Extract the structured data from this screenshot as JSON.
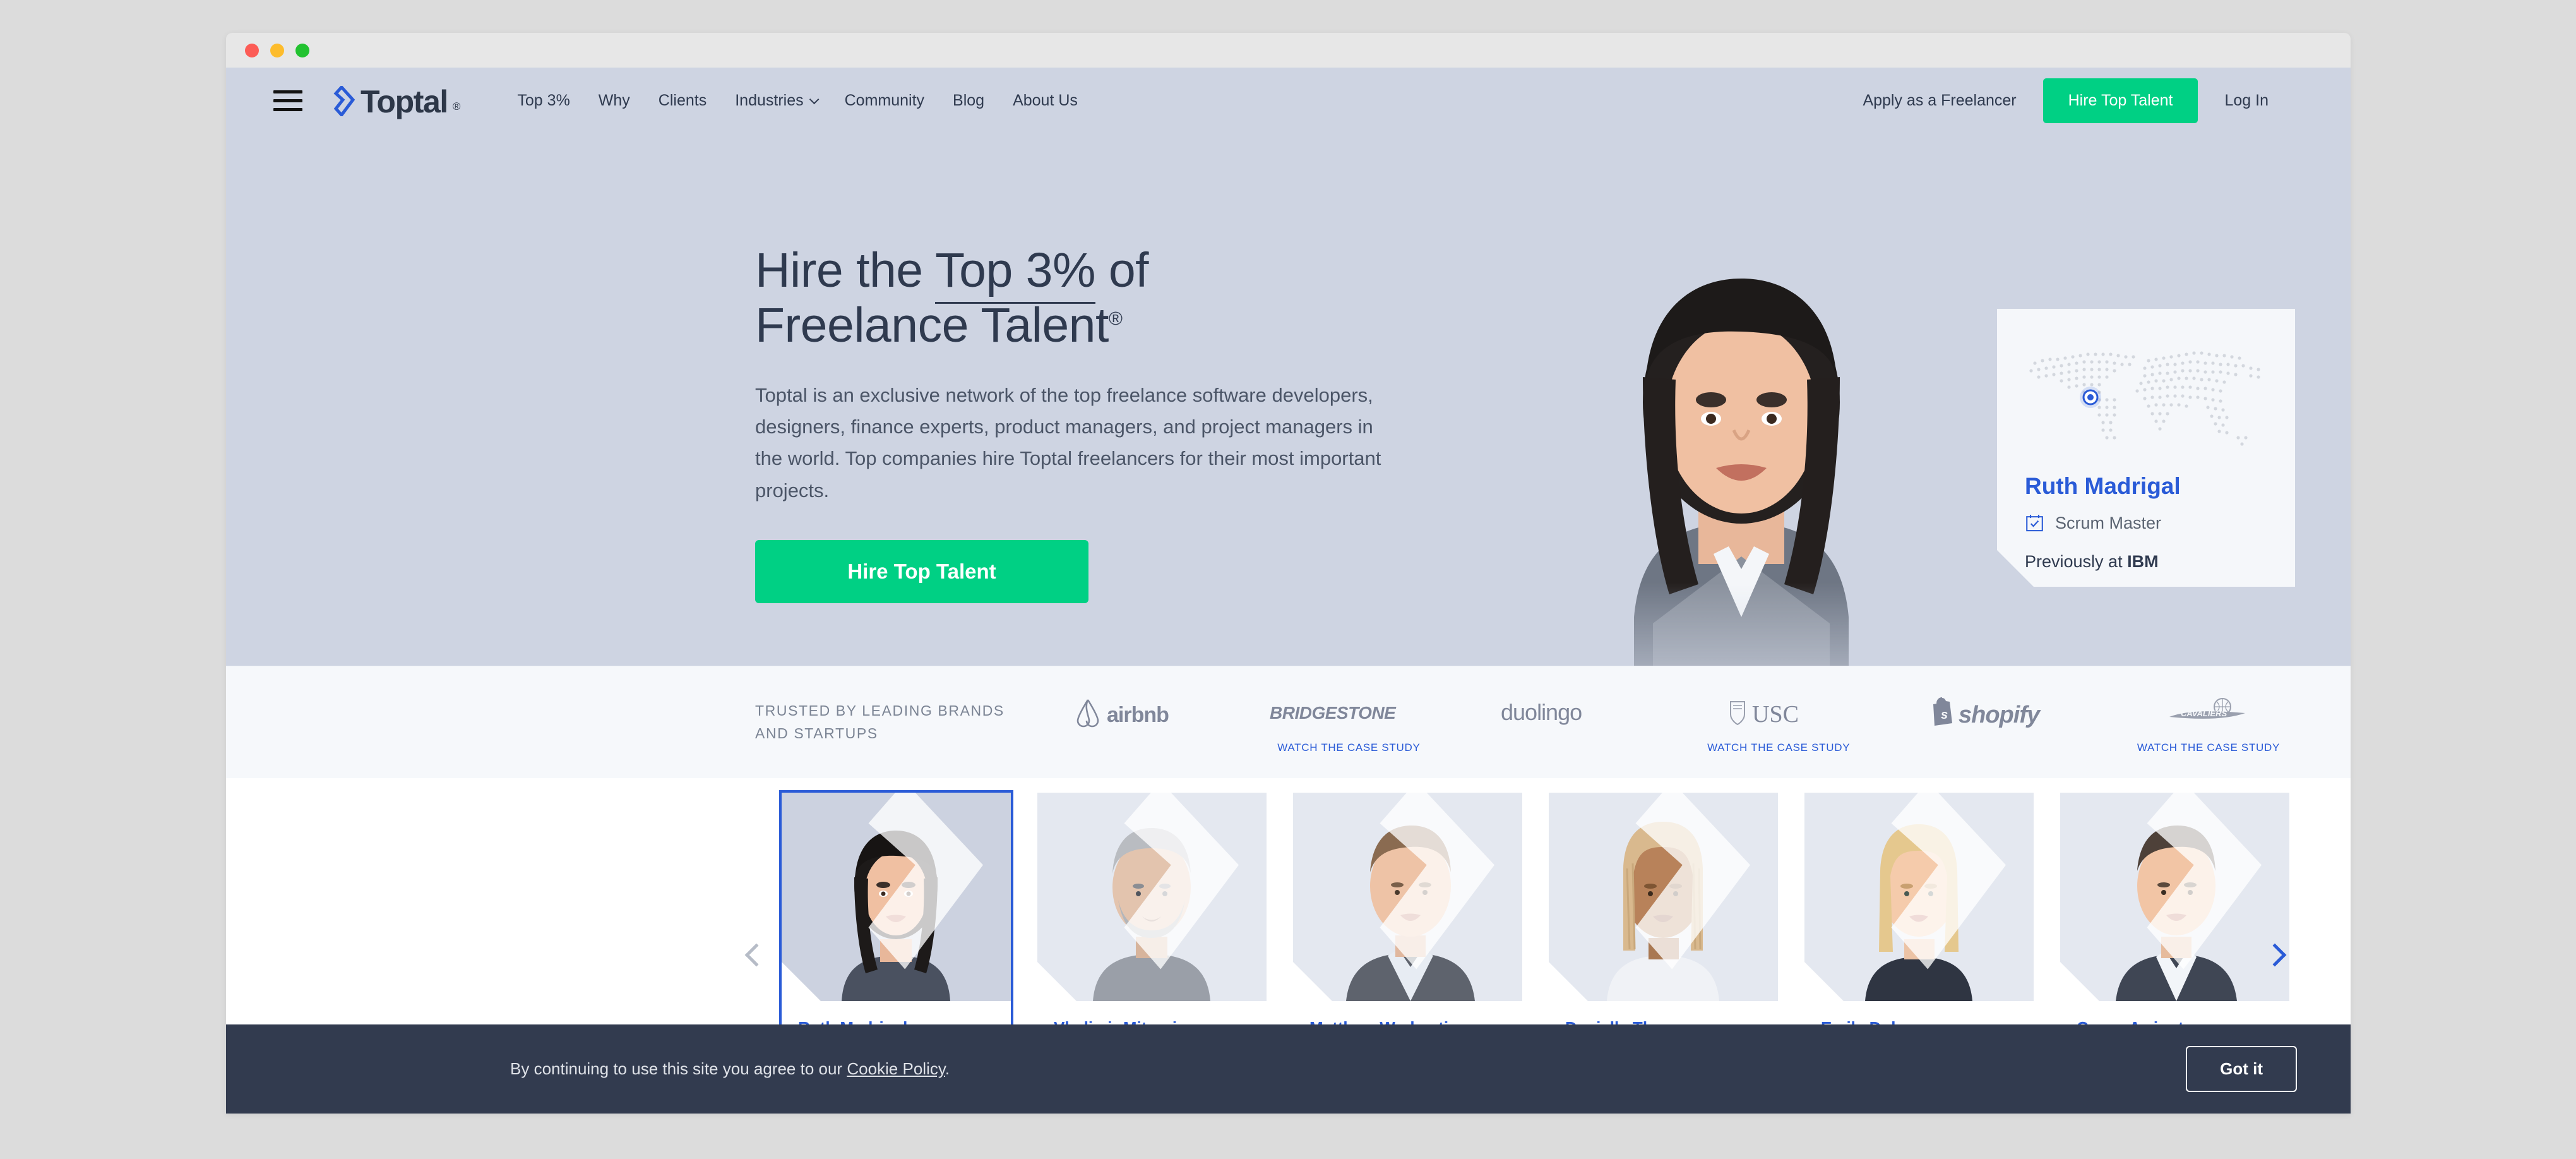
{
  "window": {
    "traffic_lights": [
      "close",
      "minimize",
      "maximize"
    ]
  },
  "header": {
    "menu_icon": "hamburger-icon",
    "logo_text": "Toptal",
    "logo_registered": "®",
    "nav": [
      {
        "label": "Top 3%",
        "has_dropdown": false
      },
      {
        "label": "Why",
        "has_dropdown": false
      },
      {
        "label": "Clients",
        "has_dropdown": false
      },
      {
        "label": "Industries",
        "has_dropdown": true
      },
      {
        "label": "Community",
        "has_dropdown": false
      },
      {
        "label": "Blog",
        "has_dropdown": false
      },
      {
        "label": "About Us",
        "has_dropdown": false
      }
    ],
    "apply_link": "Apply as a Freelancer",
    "cta_label": "Hire Top Talent",
    "login_label": "Log In"
  },
  "hero": {
    "title_part1": "Hire the ",
    "title_underlined": "Top 3%",
    "title_part2": " of",
    "title_line2": "Freelance Talent",
    "title_superscript": "®",
    "description": "Toptal is an exclusive network of the top freelance software developers, designers, finance experts, product managers, and project managers in the world. Top companies hire Toptal freelancers for their most important projects.",
    "cta_label": "Hire Top Talent",
    "portrait_alt": "Ruth Madrigal portrait"
  },
  "talent_card": {
    "map_icon": "world-map-dots",
    "location_pin": "location-pin-icon",
    "name": "Ruth Madrigal",
    "role_icon": "calendar-check-icon",
    "role": "Scrum Master",
    "previous_prefix": "Previously at ",
    "previous_company": "IBM"
  },
  "brands": {
    "label": "TRUSTED BY LEADING BRANDS AND STARTUPS",
    "case_study_label": "WATCH THE CASE STUDY",
    "items": [
      {
        "name": "airbnb",
        "logo": "airbnb-logo",
        "case_study": false
      },
      {
        "name": "BRIDGESTONE",
        "logo": "bridgestone-logo",
        "case_study": true
      },
      {
        "name": "duolingo",
        "logo": "duolingo-logo",
        "case_study": false
      },
      {
        "name": "USC",
        "logo": "usc-logo",
        "case_study": true
      },
      {
        "name": "shopify",
        "logo": "shopify-logo",
        "case_study": false
      },
      {
        "name": "Cleveland Cavaliers",
        "logo": "cavaliers-logo",
        "case_study": true
      }
    ]
  },
  "carousel": {
    "prev_icon": "chevron-left-icon",
    "next_icon": "chevron-right-icon",
    "watermark_icon": "toptal-watermark-icon",
    "cards": [
      {
        "name": "Ruth Madrigal",
        "active": true
      },
      {
        "name": "Vladimir Mitrovic",
        "active": false
      },
      {
        "name": "Matthew Warkentin",
        "active": false
      },
      {
        "name": "Danielle Thompson",
        "active": false
      },
      {
        "name": "Emily Dubow",
        "active": false
      },
      {
        "name": "Casey Arrington",
        "active": false
      }
    ]
  },
  "cookie_bar": {
    "text_before": "By continuing to use this site you agree to our ",
    "link_label": "Cookie Policy",
    "text_after": ".",
    "button_label": "Got it"
  },
  "colors": {
    "green_cta": "#00d084",
    "brand_blue": "#2a5bd7",
    "hero_bg": "#ced4e2",
    "dark_navy": "#323b4f"
  }
}
